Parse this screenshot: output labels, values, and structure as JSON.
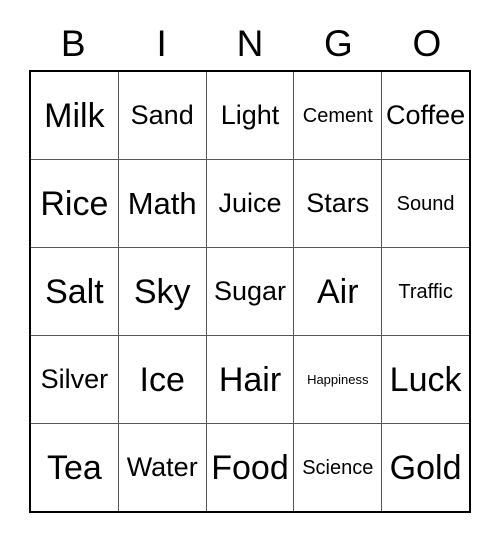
{
  "card": {
    "title": "BINGO",
    "columns": [
      "B",
      "I",
      "N",
      "G",
      "O"
    ],
    "rows": [
      [
        {
          "text": "Milk",
          "size": "xl"
        },
        {
          "text": "Sand",
          "size": "md"
        },
        {
          "text": "Light",
          "size": "md"
        },
        {
          "text": "Cement",
          "size": "sm"
        },
        {
          "text": "Coffee",
          "size": "md"
        }
      ],
      [
        {
          "text": "Rice",
          "size": "xl"
        },
        {
          "text": "Math",
          "size": "lg"
        },
        {
          "text": "Juice",
          "size": "md"
        },
        {
          "text": "Stars",
          "size": "md"
        },
        {
          "text": "Sound",
          "size": "sm"
        }
      ],
      [
        {
          "text": "Salt",
          "size": "xl"
        },
        {
          "text": "Sky",
          "size": "xl"
        },
        {
          "text": "Sugar",
          "size": "md"
        },
        {
          "text": "Air",
          "size": "xl"
        },
        {
          "text": "Traffic",
          "size": "sm"
        }
      ],
      [
        {
          "text": "Silver",
          "size": "md"
        },
        {
          "text": "Ice",
          "size": "xl"
        },
        {
          "text": "Hair",
          "size": "xl"
        },
        {
          "text": "Happiness",
          "size": "xs"
        },
        {
          "text": "Luck",
          "size": "xl"
        }
      ],
      [
        {
          "text": "Tea",
          "size": "xl"
        },
        {
          "text": "Water",
          "size": "md"
        },
        {
          "text": "Food",
          "size": "xl"
        },
        {
          "text": "Science",
          "size": "sm"
        },
        {
          "text": "Gold",
          "size": "xl"
        }
      ]
    ]
  },
  "colors": {
    "background": "#ffffff",
    "text": "#000000",
    "outer_border": "#000000",
    "grid_line": "#555555"
  }
}
